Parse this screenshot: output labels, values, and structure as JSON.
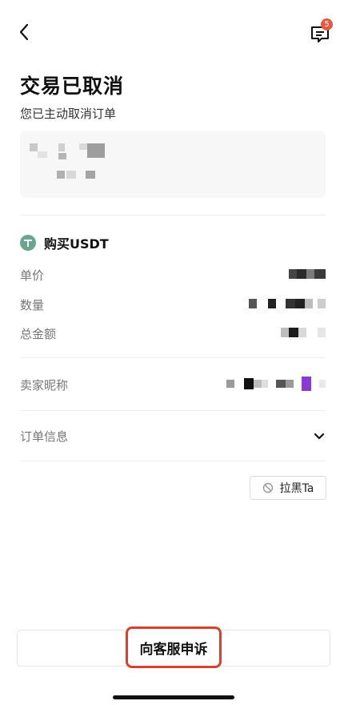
{
  "header": {
    "back_icon": "chevron-left-icon",
    "message_icon": "message-icon",
    "message_badge": "5",
    "badge_color": "#e35a3d"
  },
  "status": {
    "title": "交易已取消",
    "subtitle": "您已主动取消订单"
  },
  "order": {
    "asset_label": "购买USDT",
    "asset_icon": "tether-icon",
    "asset_icon_color": "#6aa58e",
    "rows": [
      {
        "label": "单价"
      },
      {
        "label": "数量"
      },
      {
        "label": "总金额"
      }
    ],
    "seller_label": "卖家昵称",
    "order_info_label": "订单信息"
  },
  "actions": {
    "block_label": "拉黑Ta",
    "appeal_label": "向客服申诉",
    "highlight_color": "#d9412f"
  }
}
